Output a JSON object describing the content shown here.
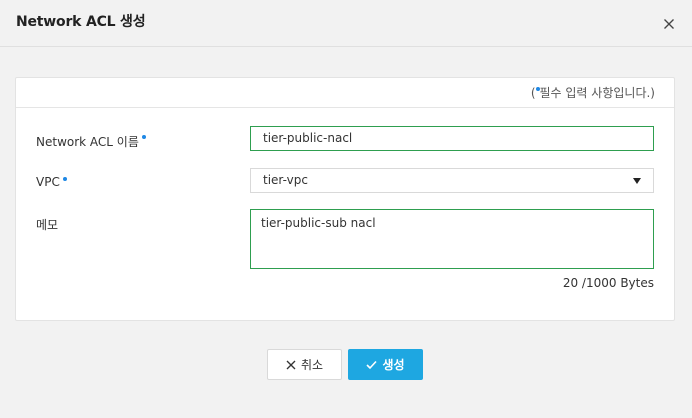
{
  "dialog": {
    "title": "Network ACL 생성"
  },
  "form": {
    "required_note_prefix": "(",
    "required_note_text": "필수 입력 사항입니다.)",
    "name_label": "Network ACL 이름",
    "name_value": "tier-public-nacl",
    "vpc_label": "VPC",
    "vpc_value": "tier-vpc",
    "memo_label": "메모",
    "memo_value": "tier-public-sub nacl",
    "byte_counter": "20 /1000 Bytes"
  },
  "buttons": {
    "cancel_label": "취소",
    "create_label": "생성"
  },
  "colors": {
    "accent_blue": "#1ea7e1",
    "required_dot": "#1e88e5",
    "focus_green": "#2e9e4f"
  },
  "icons": {
    "close": "close-icon",
    "cancel": "x-icon",
    "create": "check-icon",
    "select": "caret-down-icon"
  }
}
